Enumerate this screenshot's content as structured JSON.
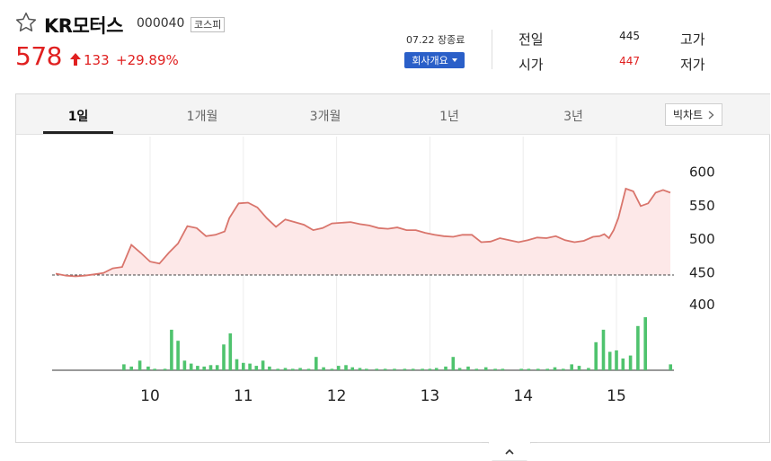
{
  "header": {
    "name": "KR모터스",
    "code": "000040",
    "market": "코스피",
    "price": "578",
    "change": "133",
    "change_pct": "+29.89%",
    "up_color": "#e02020",
    "star_icon": "star-outline-icon",
    "arrow_icon": "arrow-up-icon"
  },
  "status": {
    "time": "07.22 장종료",
    "company_button": "회사개요"
  },
  "info": {
    "row1": {
      "label": "전일",
      "value": "445",
      "label2": "고가"
    },
    "row2": {
      "label": "시가",
      "value": "447",
      "label2": "저가"
    }
  },
  "tabs": [
    "1일",
    "1개월",
    "3개월",
    "1년",
    "3년"
  ],
  "active_tab": "1일",
  "bigchart_label": "빅차트",
  "chart_data": {
    "type": "line",
    "title": "",
    "x_ticks": [
      "10",
      "11",
      "12",
      "13",
      "14",
      "15"
    ],
    "y_ticks": [
      600,
      550,
      500,
      450,
      400
    ],
    "ylim": [
      400,
      600
    ],
    "baseline": 445,
    "line_color": "#d9756c",
    "fill_color": "#fde8e8",
    "volume_color": "#4fc36e",
    "x_time": [
      9.0,
      9.1,
      9.2,
      9.3,
      9.4,
      9.5,
      9.6,
      9.7,
      9.8,
      9.9,
      10.0,
      10.1,
      10.2,
      10.3,
      10.4,
      10.5,
      10.6,
      10.7,
      10.8,
      10.85,
      10.95,
      11.05,
      11.15,
      11.25,
      11.35,
      11.45,
      11.55,
      11.65,
      11.75,
      11.85,
      11.95,
      12.05,
      12.15,
      12.25,
      12.35,
      12.45,
      12.55,
      12.65,
      12.75,
      12.85,
      12.95,
      13.05,
      13.15,
      13.25,
      13.35,
      13.45,
      13.55,
      13.65,
      13.75,
      13.85,
      13.95,
      14.05,
      14.15,
      14.25,
      14.35,
      14.45,
      14.55,
      14.65,
      14.75,
      14.82,
      14.87,
      14.92,
      14.97,
      15.02,
      15.1,
      15.18,
      15.26,
      15.34,
      15.42,
      15.5,
      15.6
    ],
    "price": [
      447,
      444,
      443,
      444,
      446,
      448,
      455,
      457,
      490,
      478,
      465,
      462,
      478,
      492,
      518,
      515,
      503,
      505,
      510,
      530,
      552,
      553,
      546,
      530,
      517,
      528,
      524,
      520,
      512,
      515,
      522,
      523,
      524,
      521,
      519,
      515,
      514,
      516,
      512,
      512,
      508,
      505,
      503,
      502,
      505,
      505,
      494,
      495,
      500,
      497,
      494,
      497,
      501,
      500,
      503,
      497,
      494,
      496,
      502,
      503,
      506,
      500,
      512,
      530,
      574,
      570,
      548,
      552,
      568,
      572,
      568
    ],
    "volume": [
      [
        "9.72",
        8
      ],
      [
        "9.8",
        5
      ],
      [
        "9.89",
        13
      ],
      [
        "9.98",
        5
      ],
      [
        "10.05",
        2
      ],
      [
        "10.16",
        2
      ],
      [
        "10.23",
        55
      ],
      [
        "10.3",
        40
      ],
      [
        "10.37",
        13
      ],
      [
        "10.44",
        9
      ],
      [
        "10.51",
        6
      ],
      [
        "10.58",
        5
      ],
      [
        "10.65",
        7
      ],
      [
        "10.72",
        7
      ],
      [
        "10.79",
        35
      ],
      [
        "10.86",
        50
      ],
      [
        "10.93",
        15
      ],
      [
        "11.0",
        10
      ],
      [
        "11.07",
        9
      ],
      [
        "11.14",
        6
      ],
      [
        "11.21",
        13
      ],
      [
        "11.28",
        5
      ],
      [
        "11.37",
        2
      ],
      [
        "11.45",
        3
      ],
      [
        "11.53",
        2
      ],
      [
        "11.61",
        3
      ],
      [
        "11.7",
        2
      ],
      [
        "11.78",
        18
      ],
      [
        "11.86",
        4
      ],
      [
        "11.95",
        2
      ],
      [
        "12.02",
        6
      ],
      [
        "12.1",
        7
      ],
      [
        "12.17",
        4
      ],
      [
        "12.25",
        3
      ],
      [
        "12.32",
        2
      ],
      [
        "12.43",
        2
      ],
      [
        "12.52",
        2
      ],
      [
        "12.62",
        2
      ],
      [
        "12.73",
        2
      ],
      [
        "12.82",
        2
      ],
      [
        "12.92",
        2
      ],
      [
        "13.0",
        2
      ],
      [
        "13.07",
        3
      ],
      [
        "13.17",
        5
      ],
      [
        "13.25",
        18
      ],
      [
        "13.32",
        3
      ],
      [
        "13.41",
        5
      ],
      [
        "13.5",
        2
      ],
      [
        "13.6",
        4
      ],
      [
        "13.7",
        2
      ],
      [
        "13.78",
        2
      ],
      [
        "13.98",
        2
      ],
      [
        "14.06",
        2
      ],
      [
        "14.16",
        2
      ],
      [
        "14.26",
        2
      ],
      [
        "14.34",
        4
      ],
      [
        "14.43",
        2
      ],
      [
        "14.52",
        8
      ],
      [
        "14.6",
        6
      ],
      [
        "14.7",
        3
      ],
      [
        "14.78",
        38
      ],
      [
        "14.86",
        55
      ],
      [
        "14.93",
        25
      ],
      [
        "15.0",
        27
      ],
      [
        "15.07",
        16
      ],
      [
        "15.15",
        20
      ],
      [
        "15.23",
        60
      ],
      [
        "15.31",
        72
      ],
      [
        "15.58",
        8
      ]
    ]
  }
}
